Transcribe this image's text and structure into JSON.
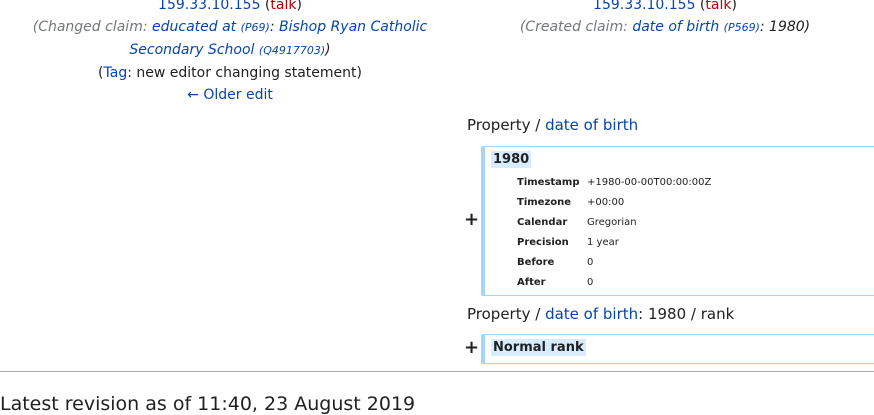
{
  "left": {
    "user_ip": "159.33.10.155",
    "talk": "talk",
    "summary_prefix": "(Changed claim: ",
    "property_link": "educated at",
    "property_id": "(P69)",
    "value_prefix": ":",
    "value_link": "Bishop Ryan Catholic Secondary School",
    "value_id": "(Q4917703)",
    "summary_close": ")",
    "tag_label": "Tag",
    "tag_text": ": new editor changing statement)",
    "older_edit": "← Older edit"
  },
  "right": {
    "user_ip": "159.33.10.155",
    "talk": "talk",
    "summary_prefix": "(Created claim: ",
    "property_link": "date of birth",
    "property_id": "(P569)",
    "summary_value": ": 1980)"
  },
  "diff1": {
    "heading_prefix": "Property / ",
    "heading_link": "date of birth",
    "plus": "+",
    "value": "1980",
    "rows": [
      {
        "key": "Timestamp",
        "value": "+1980-00-00T00:00:00Z"
      },
      {
        "key": "Timezone",
        "value": "+00:00"
      },
      {
        "key": "Calendar",
        "value": "Gregorian"
      },
      {
        "key": "Precision",
        "value": "1 year"
      },
      {
        "key": "Before",
        "value": "0"
      },
      {
        "key": "After",
        "value": "0"
      }
    ]
  },
  "diff2": {
    "heading_prefix": "Property / ",
    "heading_link": "date of birth",
    "heading_suffix": ": 1980 / rank",
    "plus": "+",
    "value": "Normal rank"
  },
  "footer": {
    "latest_revision": "Latest revision as of 11:40, 23 August 2019"
  },
  "colors": {
    "link": "#0645ad",
    "talk": "#ba0000",
    "added_border": "#a3d3ff",
    "added_highlight": "#d8ecff"
  }
}
